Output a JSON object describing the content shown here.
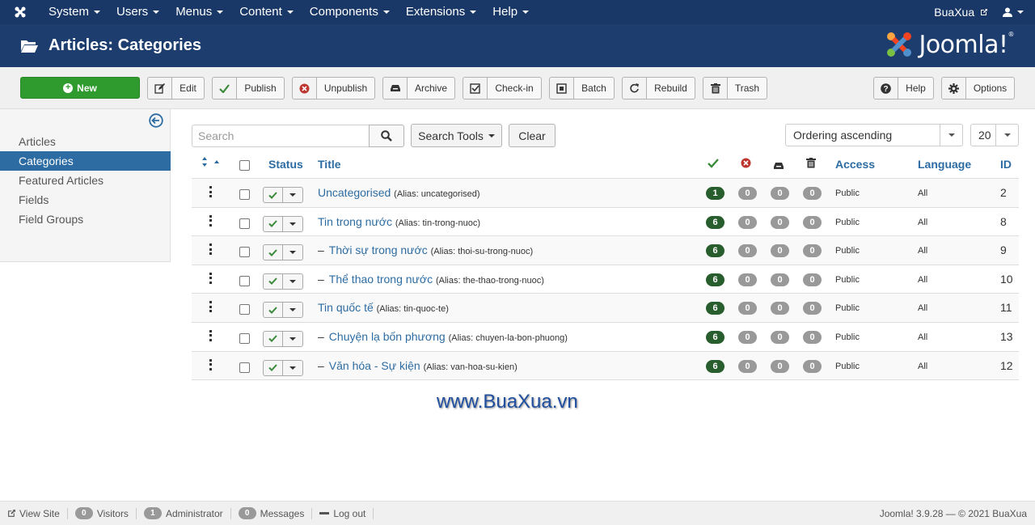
{
  "topnav": {
    "menu": [
      "System",
      "Users",
      "Menus",
      "Content",
      "Components",
      "Extensions",
      "Help"
    ],
    "site_link": "BuaXua"
  },
  "header": {
    "title": "Articles: Categories",
    "brand": "Joomla!",
    "brand_sup": "®"
  },
  "toolbar": {
    "new": "New",
    "edit": "Edit",
    "publish": "Publish",
    "unpublish": "Unpublish",
    "archive": "Archive",
    "checkin": "Check-in",
    "batch": "Batch",
    "rebuild": "Rebuild",
    "trash": "Trash",
    "help": "Help",
    "options": "Options"
  },
  "sidebar": {
    "items": [
      "Articles",
      "Categories",
      "Featured Articles",
      "Fields",
      "Field Groups"
    ],
    "active": "Categories"
  },
  "filters": {
    "search_placeholder": "Search",
    "search_tools": "Search Tools",
    "clear": "Clear",
    "ordering": "Ordering ascending",
    "limit": "20"
  },
  "table": {
    "headers": {
      "status": "Status",
      "title": "Title",
      "access": "Access",
      "language": "Language",
      "id": "ID"
    },
    "rows": [
      {
        "dash": "",
        "title": "Uncategorised",
        "alias": "(Alias: uncategorised)",
        "published": "1",
        "unpublished": "0",
        "archived": "0",
        "trashed": "0",
        "access": "Public",
        "language": "All",
        "id": "2"
      },
      {
        "dash": "",
        "title": "Tin trong nước",
        "alias": "(Alias: tin-trong-nuoc)",
        "published": "6",
        "unpublished": "0",
        "archived": "0",
        "trashed": "0",
        "access": "Public",
        "language": "All",
        "id": "8"
      },
      {
        "dash": "–",
        "title": "Thời sự trong nước",
        "alias": "(Alias: thoi-su-trong-nuoc)",
        "published": "6",
        "unpublished": "0",
        "archived": "0",
        "trashed": "0",
        "access": "Public",
        "language": "All",
        "id": "9"
      },
      {
        "dash": "–",
        "title": "Thể thao trong nước",
        "alias": "(Alias: the-thao-trong-nuoc)",
        "published": "6",
        "unpublished": "0",
        "archived": "0",
        "trashed": "0",
        "access": "Public",
        "language": "All",
        "id": "10"
      },
      {
        "dash": "",
        "title": "Tin quốc tế",
        "alias": "(Alias: tin-quoc-te)",
        "published": "6",
        "unpublished": "0",
        "archived": "0",
        "trashed": "0",
        "access": "Public",
        "language": "All",
        "id": "11"
      },
      {
        "dash": "–",
        "title": "Chuyện lạ bốn phương",
        "alias": "(Alias: chuyen-la-bon-phuong)",
        "published": "6",
        "unpublished": "0",
        "archived": "0",
        "trashed": "0",
        "access": "Public",
        "language": "All",
        "id": "13"
      },
      {
        "dash": "–",
        "title": "Văn hóa - Sự kiện",
        "alias": "(Alias: van-hoa-su-kien)",
        "published": "6",
        "unpublished": "0",
        "archived": "0",
        "trashed": "0",
        "access": "Public",
        "language": "All",
        "id": "12"
      }
    ]
  },
  "watermark": "www.BuaXua.vn",
  "footer": {
    "view_site": "View Site",
    "visitors_count": "0",
    "visitors": "Visitors",
    "admin_count": "1",
    "administrator": "Administrator",
    "messages_count": "0",
    "messages": "Messages",
    "logout": "Log out",
    "copyright": "Joomla! 3.9.28  —  © 2021 BuaXua"
  },
  "colors": {
    "nav": "#1a3867",
    "header": "#1c3d6e",
    "new_button": "#2f9b2f",
    "link": "#2d6ca2",
    "badge_published": "#285d2d",
    "badge_zero": "#999999"
  }
}
